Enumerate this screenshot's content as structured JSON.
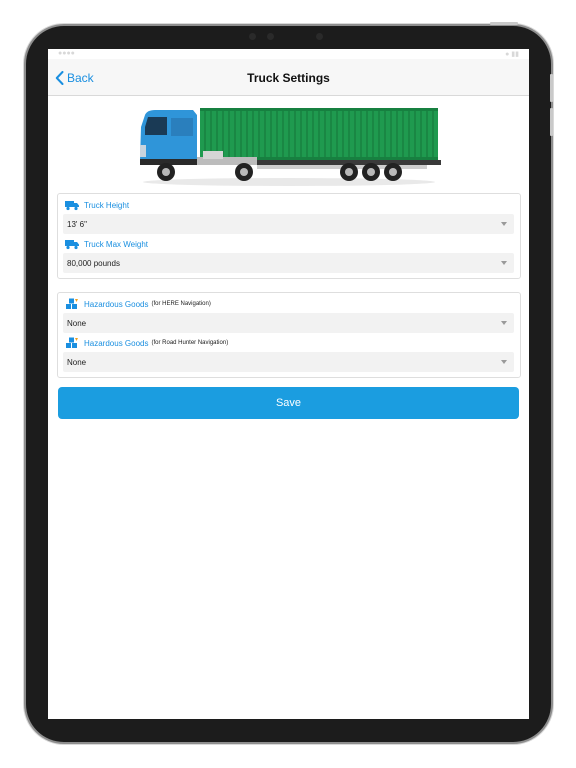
{
  "nav": {
    "back_label": "Back",
    "title": "Truck Settings"
  },
  "truck_settings": {
    "height": {
      "label": "Truck Height",
      "value": "13' 6\"",
      "icon": "truck-icon"
    },
    "max_weight": {
      "label": "Truck Max Weight",
      "value": "80,000 pounds",
      "icon": "truck-icon"
    }
  },
  "hazardous": {
    "here": {
      "label": "Hazardous Goods",
      "suffix": "(for HERE Navigation)",
      "value": "None",
      "icon": "hazard-boxes-icon"
    },
    "road_hunter": {
      "label": "Hazardous Goods",
      "suffix": "(for Road Hunter Navigation)",
      "value": "None",
      "icon": "hazard-boxes-icon"
    }
  },
  "actions": {
    "save_label": "Save"
  },
  "colors": {
    "accent": "#1a8fe0",
    "save_button": "#1b9de0",
    "container": "#1f9a4f",
    "cab": "#2f95d9"
  }
}
